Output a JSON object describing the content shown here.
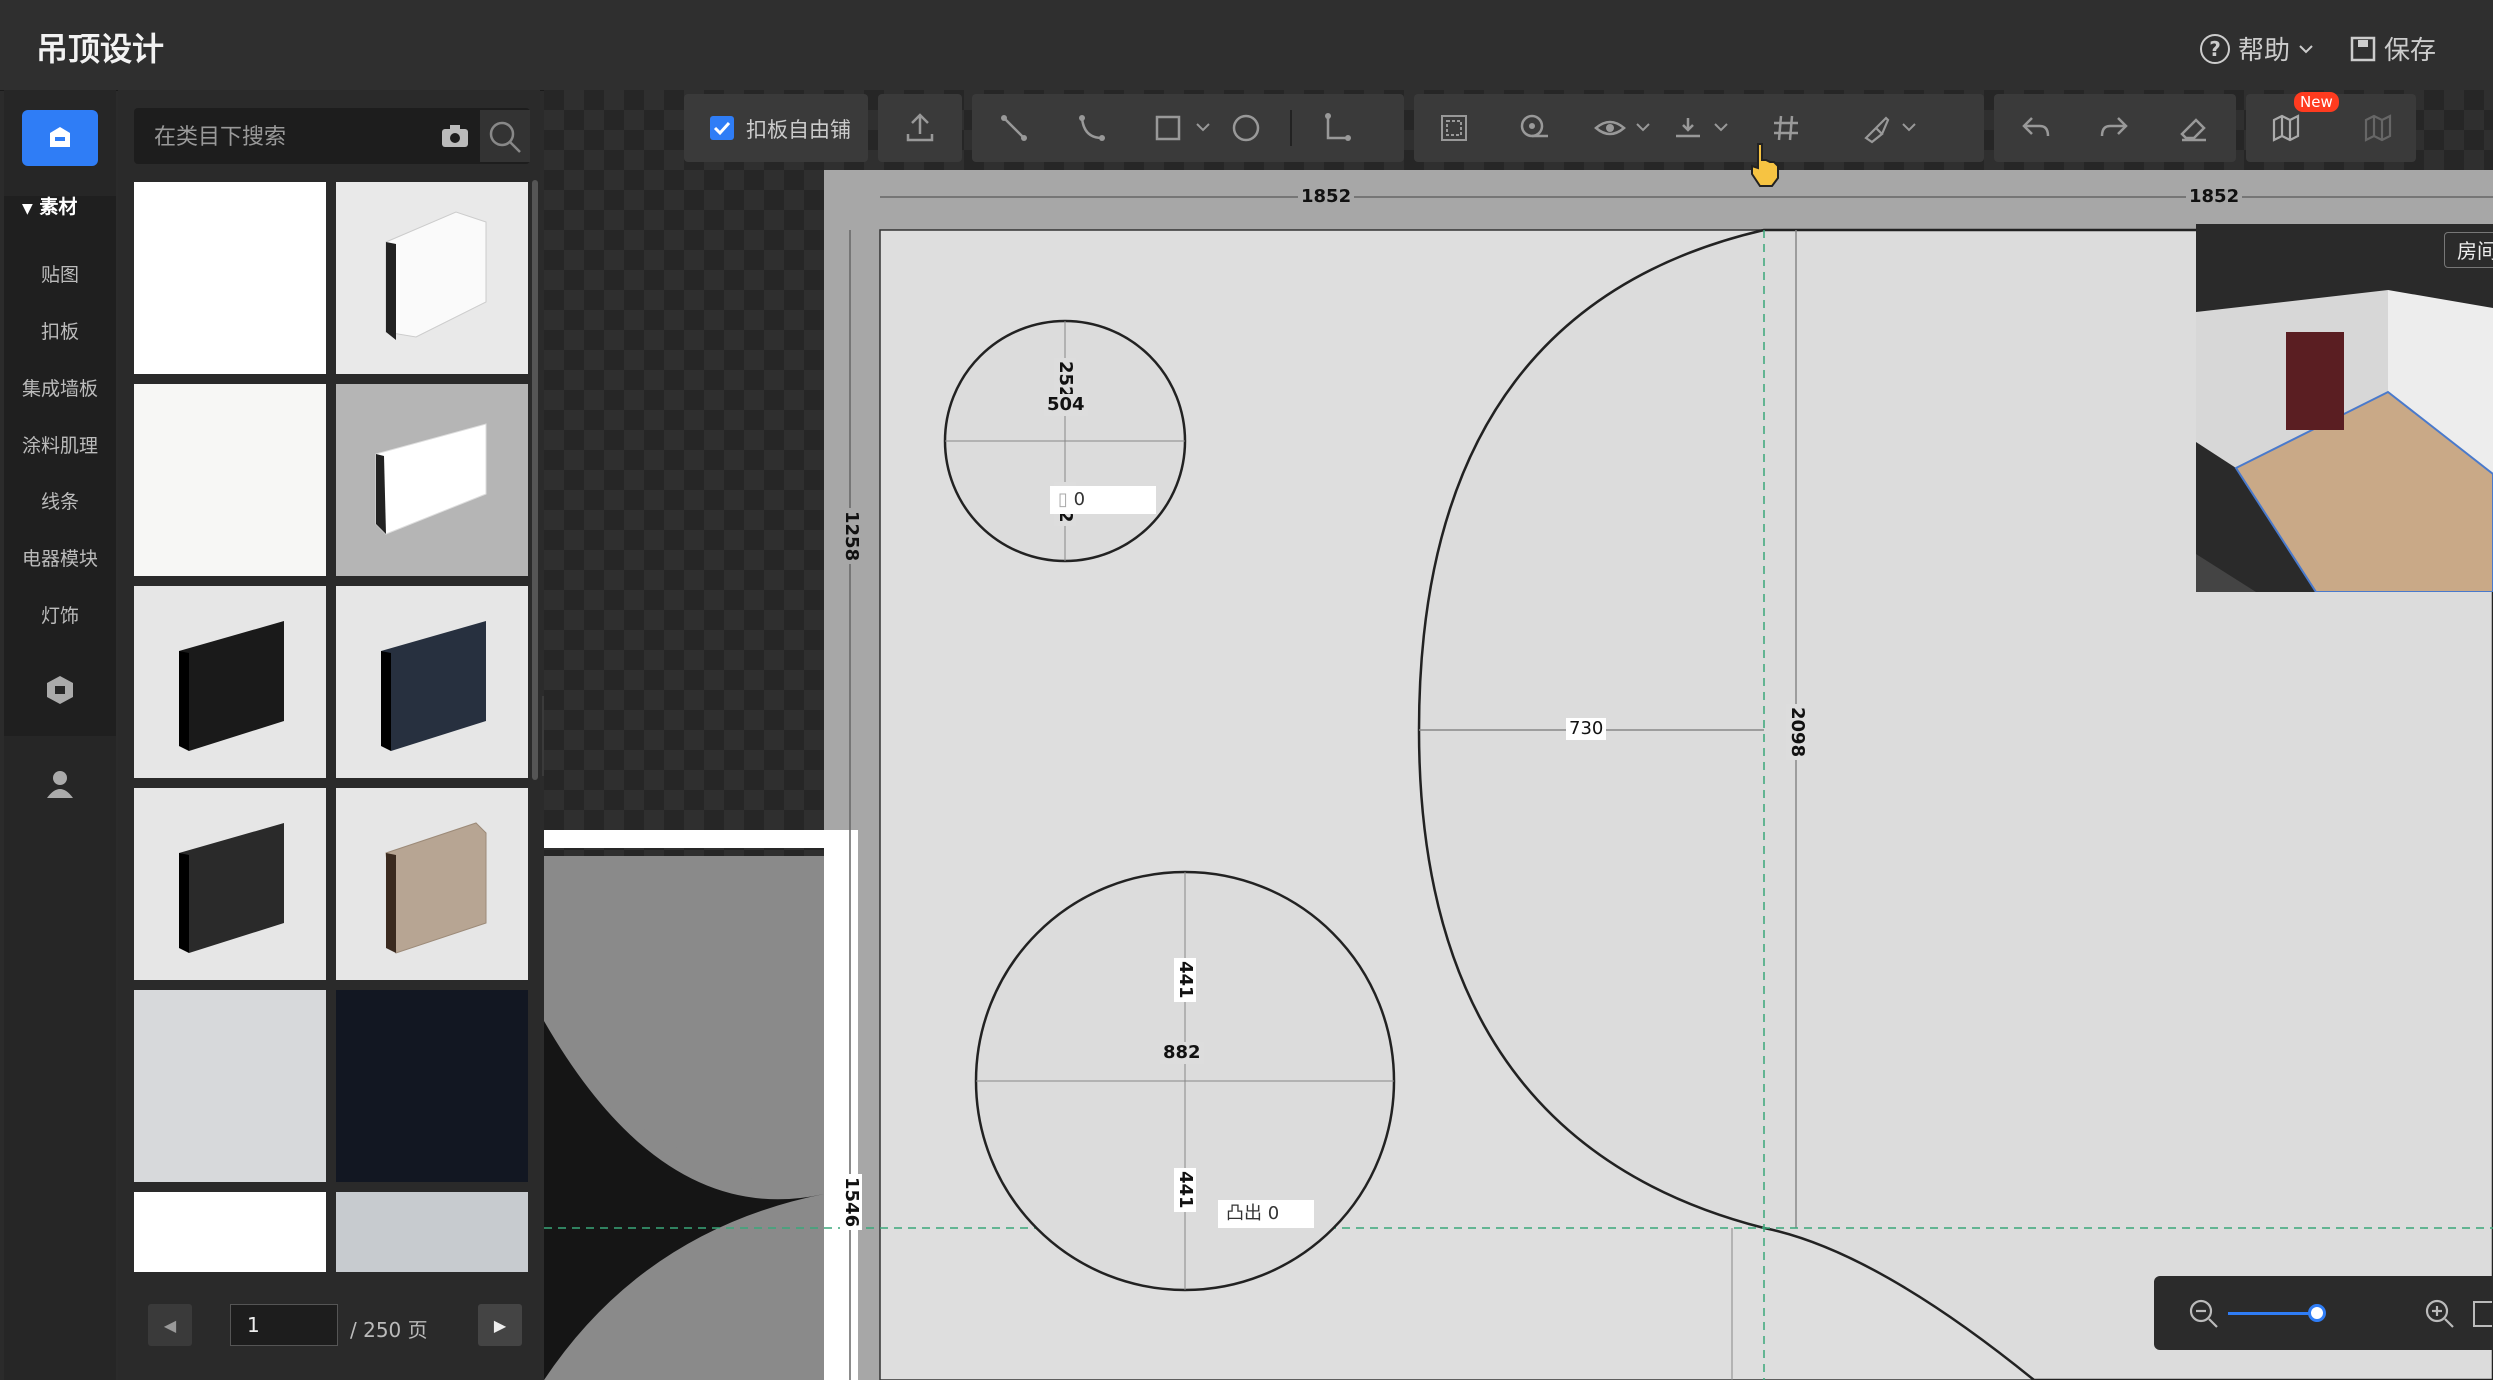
{
  "app": {
    "title": "吊顶设计"
  },
  "header": {
    "help_label": "帮助",
    "save_label": "保存"
  },
  "rail": {
    "section_title": "素材",
    "categories": [
      "贴图",
      "扣板",
      "集成墙板",
      "涂料肌理",
      "线条",
      "电器模块",
      "灯饰"
    ]
  },
  "search": {
    "placeholder": "在类目下搜索"
  },
  "pager": {
    "current": "1",
    "total_label": "/ 250 页"
  },
  "toolbar": {
    "free_tile_label": "扣板自由铺",
    "free_tile_checked": true,
    "new_badge": "New"
  },
  "dimensions": {
    "top_left": "1852",
    "top_right": "1852",
    "left_upper": "1258",
    "left_lower": "1546",
    "small_circle_top": "252",
    "small_circle_diameter": "504",
    "small_circle_bottom": "252",
    "small_circle_tag_value": "0",
    "big_arc_radius": "730",
    "big_arc_height": "2098",
    "mid_circle_top": "441",
    "mid_circle_diameter": "882",
    "mid_circle_bottom": "441",
    "mid_circle_tag_label": "凸出",
    "mid_circle_tag_value": "0"
  },
  "preview": {
    "button_label": "房间"
  },
  "colors": {
    "accent": "#2f7df6",
    "badge": "#ff3b1f",
    "guide": "#3aa77a"
  }
}
